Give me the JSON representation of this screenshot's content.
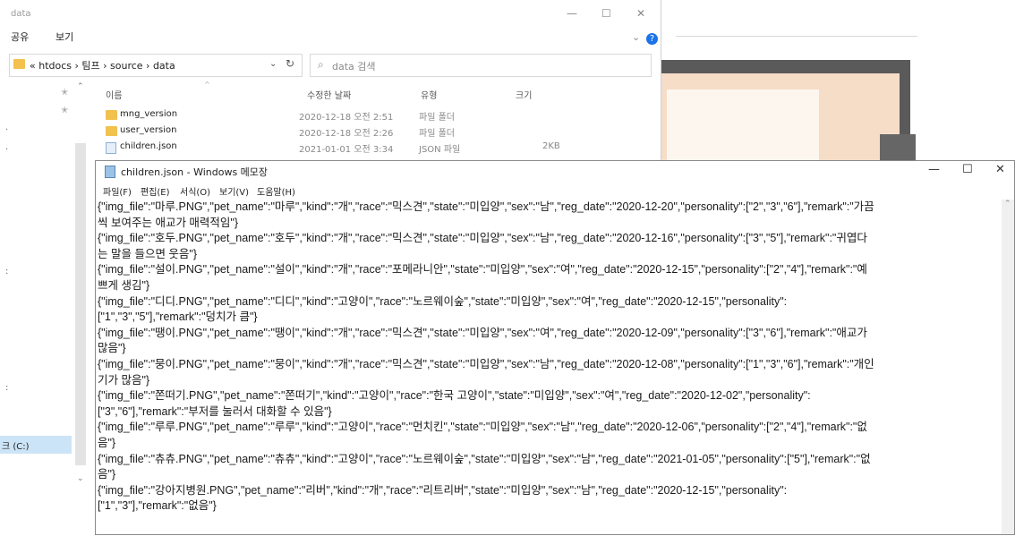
{
  "explorer": {
    "title": "data",
    "menu": [
      "공유",
      "보기"
    ],
    "chevron": "⌄",
    "help": "?",
    "address": {
      "crumbs": "« htdocs › 팀프 › source › data",
      "dropdown": "⌄",
      "refresh": "↻"
    },
    "search": {
      "placeholder": "data 검색"
    },
    "columns": {
      "name": "이름",
      "modified": "수정한 날짜",
      "type": "유형",
      "size": "크기"
    },
    "files": [
      {
        "name": "mng_version",
        "modified": "2020-12-18 오전 2:51",
        "type": "파일 폴더",
        "size": "",
        "icon": "folder-icon"
      },
      {
        "name": "user_version",
        "modified": "2020-12-18 오전 2:26",
        "type": "파일 폴더",
        "size": "",
        "icon": "folder-icon"
      },
      {
        "name": "children.json",
        "modified": "2021-01-01 오전 3:34",
        "type": "JSON 파일",
        "size": "2KB",
        "icon": "file-icon"
      }
    ],
    "nav": {
      "drive_label": "크 (C:)"
    }
  },
  "notepad": {
    "title": "children.json - Windows 메모장",
    "menu": [
      "파일(F)",
      "편집(E)",
      "서식(O)",
      "보기(V)",
      "도움말(H)"
    ],
    "controls": {
      "minimize": "—",
      "maximize": "☐",
      "close": "✕"
    },
    "lines": [
      "{\"img_file\":\"마루.PNG\",\"pet_name\":\"마루\",\"kind\":\"개\",\"race\":\"믹스견\",\"state\":\"미입양\",\"sex\":\"남\",\"reg_date\":\"2020-12-20\",\"personality\":[\"2\",\"3\",\"6\"],\"remark\":\"가끔",
      "씩 보여주는 애교가 매력적임\"}",
      "{\"img_file\":\"호두.PNG\",\"pet_name\":\"호두\",\"kind\":\"개\",\"race\":\"믹스견\",\"state\":\"미입양\",\"sex\":\"남\",\"reg_date\":\"2020-12-16\",\"personality\":[\"3\",\"5\"],\"remark\":\"귀엽다",
      "는 말을 들으면 웃음\"}",
      "{\"img_file\":\"설이.PNG\",\"pet_name\":\"설이\",\"kind\":\"개\",\"race\":\"포메라니안\",\"state\":\"미입양\",\"sex\":\"여\",\"reg_date\":\"2020-12-15\",\"personality\":[\"2\",\"4\"],\"remark\":\"예",
      "쁘게 생김\"}",
      "{\"img_file\":\"디디.PNG\",\"pet_name\":\"디디\",\"kind\":\"고양이\",\"race\":\"노르웨이숲\",\"state\":\"미입양\",\"sex\":\"여\",\"reg_date\":\"2020-12-15\",\"personality\":",
      "[\"1\",\"3\",\"5\"],\"remark\":\"덩치가 큼\"}",
      "{\"img_file\":\"땡이.PNG\",\"pet_name\":\"땡이\",\"kind\":\"개\",\"race\":\"믹스견\",\"state\":\"미입양\",\"sex\":\"여\",\"reg_date\":\"2020-12-09\",\"personality\":[\"3\",\"6\"],\"remark\":\"애교가",
      "많음\"}",
      "{\"img_file\":\"뭉이.PNG\",\"pet_name\":\"뭉이\",\"kind\":\"개\",\"race\":\"믹스견\",\"state\":\"미입양\",\"sex\":\"남\",\"reg_date\":\"2020-12-08\",\"personality\":[\"1\",\"3\",\"6\"],\"remark\":\"개인",
      "기가 많음\"}",
      "{\"img_file\":\"쫀떠기.PNG\",\"pet_name\":\"쫀떠기\",\"kind\":\"고양이\",\"race\":\"한국 고양이\",\"state\":\"미입양\",\"sex\":\"여\",\"reg_date\":\"2020-12-02\",\"personality\":",
      "[\"3\",\"6\"],\"remark\":\"부저를 눌러서 대화할 수 있음\"}",
      "{\"img_file\":\"루루.PNG\",\"pet_name\":\"루루\",\"kind\":\"고양이\",\"race\":\"먼치킨\",\"state\":\"미입양\",\"sex\":\"남\",\"reg_date\":\"2020-12-06\",\"personality\":[\"2\",\"4\"],\"remark\":\"없",
      "음\"}",
      "{\"img_file\":\"츄츄.PNG\",\"pet_name\":\"츄츄\",\"kind\":\"고양이\",\"race\":\"노르웨이숲\",\"state\":\"미입양\",\"sex\":\"남\",\"reg_date\":\"2021-01-05\",\"personality\":[\"5\"],\"remark\":\"없",
      "음\"}",
      "{\"img_file\":\"강아지병원.PNG\",\"pet_name\":\"리버\",\"kind\":\"개\",\"race\":\"리트리버\",\"state\":\"미입양\",\"sex\":\"남\",\"reg_date\":\"2020-12-15\",\"personality\":",
      "[\"1\",\"3\"],\"remark\":\"없음\"}"
    ]
  }
}
